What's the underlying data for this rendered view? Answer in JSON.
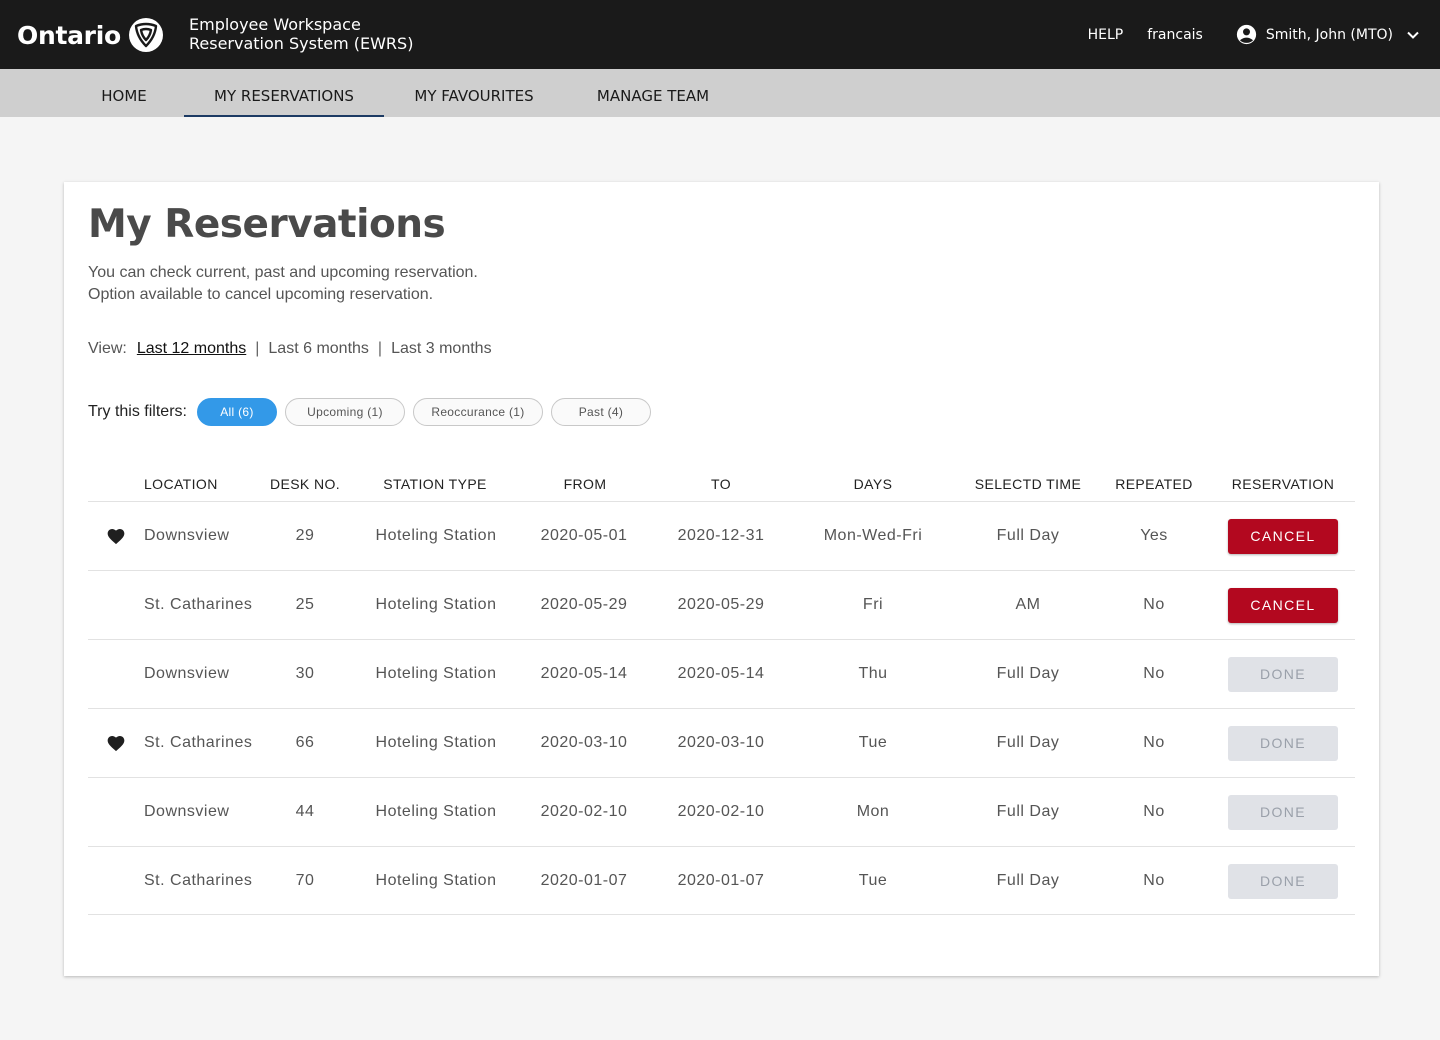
{
  "header": {
    "logo_text": "Ontario",
    "app_title_line1": "Employee Workspace",
    "app_title_line2": "Reservation System (EWRS)",
    "help": "HELP",
    "language": "francais",
    "user_name": "Smith, John (MTO)"
  },
  "nav": {
    "home": "HOME",
    "my_reservations": "MY RESERVATIONS",
    "my_favourites": "MY FAVOURITES",
    "manage_team": "MANAGE TEAM",
    "active": "MY RESERVATIONS"
  },
  "main": {
    "title": "My Reservations",
    "desc_line1": "You can check current, past and upcoming reservation.",
    "desc_line2": "Option available to cancel upcoming reservation.",
    "view_label": "View:",
    "view_options": [
      "Last 12 months",
      "Last 6 months",
      "Last 3 months"
    ],
    "view_active": "Last 12 months",
    "filters_label": "Try this filters:",
    "filters": [
      "All (6)",
      "Upcoming (1)",
      "Reoccurance (1)",
      "Past (4)"
    ],
    "filter_active": "All (6)"
  },
  "table": {
    "headers": [
      "LOCATION",
      "DESK NO.",
      "STATION TYPE",
      "FROM",
      "TO",
      "DAYS",
      "SELECTD TIME",
      "REPEATED",
      "RESERVATION"
    ],
    "rows": [
      {
        "favourite": true,
        "location": "Downsview",
        "desk": "29",
        "station": "Hoteling Station",
        "from": "2020-05-01",
        "to": "2020-12-31",
        "days": "Mon-Wed-Fri",
        "time": "Full Day",
        "repeated": "Yes",
        "action": "CANCEL"
      },
      {
        "favourite": false,
        "location": "St. Catharines",
        "desk": "25",
        "station": "Hoteling Station",
        "from": "2020-05-29",
        "to": "2020-05-29",
        "days": "Fri",
        "time": "AM",
        "repeated": "No",
        "action": "CANCEL"
      },
      {
        "favourite": false,
        "location": "Downsview",
        "desk": "30",
        "station": "Hoteling Station",
        "from": "2020-05-14",
        "to": "2020-05-14",
        "days": "Thu",
        "time": "Full Day",
        "repeated": "No",
        "action": "DONE"
      },
      {
        "favourite": true,
        "location": "St. Catharines",
        "desk": "66",
        "station": "Hoteling Station",
        "from": "2020-03-10",
        "to": "2020-03-10",
        "days": "Tue",
        "time": "Full Day",
        "repeated": "No",
        "action": "DONE"
      },
      {
        "favourite": false,
        "location": "Downsview",
        "desk": "44",
        "station": "Hoteling Station",
        "from": "2020-02-10",
        "to": "2020-02-10",
        "days": "Mon",
        "time": "Full Day",
        "repeated": "No",
        "action": "DONE"
      },
      {
        "favourite": false,
        "location": "St. Catharines",
        "desk": "70",
        "station": "Hoteling Station",
        "from": "2020-01-07",
        "to": "2020-01-07",
        "days": "Tue",
        "time": "Full Day",
        "repeated": "No",
        "action": "DONE"
      }
    ]
  },
  "colors": {
    "topbar": "#1a1a1a",
    "nav_bg": "#cfcfcf",
    "nav_active_underline": "#1c3a63",
    "chip_active": "#3399e8",
    "cancel_button": "#b3081f",
    "done_button": "#e0e2e7"
  },
  "icons": {
    "logo": "ontario-trillium-icon",
    "user": "account-circle-icon",
    "user_menu": "chevron-down-icon",
    "favourite": "heart-icon"
  }
}
